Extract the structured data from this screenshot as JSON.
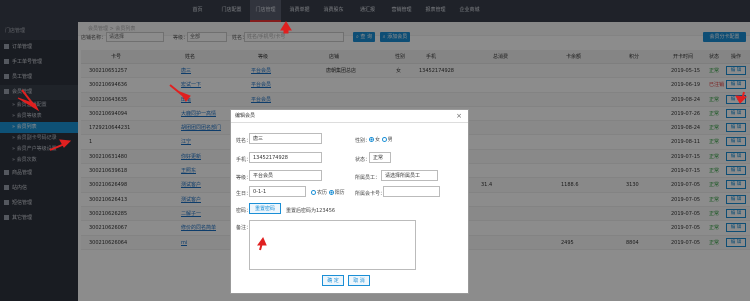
{
  "topnav": [
    "首页",
    "门店配置",
    "门店管理",
    "消费单据",
    "消费股东",
    "通汇报",
    "营销管理",
    "报表管理",
    "企业商城"
  ],
  "sidebar": {
    "head": "门店管理",
    "items": [
      {
        "label": "订单管理",
        "type": "top"
      },
      {
        "label": "手工单号管理",
        "type": "plain"
      },
      {
        "label": "员工管理",
        "type": "top"
      },
      {
        "label": "会员管理",
        "type": "open"
      },
      {
        "label": "» 会员营销配置",
        "type": "sub"
      },
      {
        "label": "» 会员等级表",
        "type": "sub"
      },
      {
        "label": "» 会员列表",
        "type": "sel"
      },
      {
        "label": "» 会员副卡号码记录",
        "type": "sub"
      },
      {
        "label": "» 会员产户等级设置",
        "type": "sub"
      },
      {
        "label": "» 会员次数",
        "type": "sub"
      },
      {
        "label": "商品管理",
        "type": "top"
      },
      {
        "label": "站内信",
        "type": "top"
      },
      {
        "label": "短信管理",
        "type": "top"
      },
      {
        "label": "其它管理",
        "type": "top"
      }
    ]
  },
  "breadcrumb": "会员管理 > 会员列表",
  "filter": {
    "store_label": "店铺名称：",
    "store_value": "请选择",
    "level_label": "等级：",
    "level_value": "全部",
    "name_label": "姓名：",
    "name_placeholder": "姓名/手机号/卡号",
    "search_btn": "查 询",
    "add_btn": "添加会员",
    "config_btn": "会员分卡配置"
  },
  "table": {
    "headers": [
      "卡号",
      "姓名",
      "等级",
      "店铺",
      "性别",
      "手机",
      "总消费",
      "卡余额",
      "积分",
      "开卡时间",
      "状态",
      "操作"
    ],
    "rows": [
      {
        "card": "300210651257",
        "name": "唐三",
        "level": "平台会员",
        "store": "唐朝集团总店",
        "sex": "女",
        "phone": "13452174928",
        "total": "",
        "balance": "",
        "points": "",
        "date": "2019-05-15",
        "status": "正常",
        "op": "编 辑"
      },
      {
        "card": "300210694636",
        "name": "宏试一下",
        "level": "平台会员",
        "store": "",
        "sex": "",
        "phone": "",
        "total": "",
        "balance": "",
        "points": "",
        "date": "2019-06-19",
        "status": "已注销",
        "op": "编 辑"
      },
      {
        "card": "300210643635",
        "name": "田龟",
        "level": "平台会员",
        "store": "",
        "sex": "",
        "phone": "",
        "total": "",
        "balance": "",
        "points": "",
        "date": "2019-08-24",
        "status": "正常",
        "op": "编 辑"
      },
      {
        "card": "300210694094",
        "name": "大鹿同护一高情",
        "level": "平台会员",
        "store": "",
        "sex": "",
        "phone": "",
        "total": "",
        "balance": "",
        "points": "",
        "date": "2019-07-26",
        "status": "正常",
        "op": "编 辑"
      },
      {
        "card": "1729210644231",
        "name": "胡团团同团名部门",
        "level": "平台会员",
        "store": "",
        "sex": "",
        "phone": "",
        "total": "",
        "balance": "",
        "points": "",
        "date": "2019-08-24",
        "status": "正常",
        "op": "编 辑"
      },
      {
        "card": "1",
        "name": "江宁",
        "level": "平台会员",
        "store": "",
        "sex": "",
        "phone": "",
        "total": "",
        "balance": "",
        "points": "",
        "date": "2019-08-11",
        "status": "正常",
        "op": "编 辑"
      },
      {
        "card": "300210631480",
        "name": "你好更新",
        "level": "平台会员",
        "store": "",
        "sex": "",
        "phone": "",
        "total": "",
        "balance": "",
        "points": "",
        "date": "2019-07-15",
        "status": "正常",
        "op": "编 辑"
      },
      {
        "card": "300210639618",
        "name": "王照东",
        "level": "平台会员",
        "store": "",
        "sex": "",
        "phone": "",
        "total": "",
        "balance": "",
        "points": "",
        "date": "2019-07-15",
        "status": "正常",
        "op": "编 辑"
      },
      {
        "card": "300210626498",
        "name": "测试客户",
        "level": "平台会员",
        "store": "",
        "sex": "",
        "phone": "",
        "total": "31.4",
        "balance": "1188.6",
        "points": "3130",
        "date": "2019-07-05",
        "status": "正常",
        "op": "编 辑"
      },
      {
        "card": "300210626413",
        "name": "测试客户",
        "level": "平台会员",
        "store": "",
        "sex": "",
        "phone": "",
        "total": "",
        "balance": "",
        "points": "",
        "date": "2019-07-05",
        "status": "正常",
        "op": "编 辑"
      },
      {
        "card": "300210626285",
        "name": "二解子一",
        "level": "平台会员",
        "store": "",
        "sex": "",
        "phone": "",
        "total": "",
        "balance": "",
        "points": "",
        "date": "2019-07-05",
        "status": "正常",
        "op": "编 辑"
      },
      {
        "card": "300210626067",
        "name": "修价的同名简单",
        "level": "平台会员",
        "store": "",
        "sex": "",
        "phone": "",
        "total": "",
        "balance": "",
        "points": "",
        "date": "2019-07-05",
        "status": "正常",
        "op": "编 辑"
      },
      {
        "card": "300210626064",
        "name": "mi",
        "level": "平台会员",
        "store": "",
        "sex": "",
        "phone": "",
        "total": "",
        "balance": "2495",
        "points": "8804",
        "date": "2019-07-05",
        "status": "正常",
        "op": "编 辑"
      }
    ]
  },
  "modal": {
    "title": "编辑会员",
    "close": "×",
    "name_label": "姓名：",
    "name_value": "唐三",
    "sex_label": "性别：",
    "sex_male": "女",
    "sex_female": "男",
    "phone_label": "手机：",
    "phone_value": "13452174928",
    "status_label": "状态：",
    "status_value": "正常",
    "level_label": "等级：",
    "level_value": "平台会员",
    "staff_label": "所属员工：",
    "staff_value": "请选择所属员工",
    "birthday_label": "生日：",
    "birthday_value": "0-1-1",
    "cal_solar": "农历",
    "cal_lunar": "阳历",
    "card_label": "所属会卡号：",
    "pwd_label": "密码：",
    "pwd_btn": "重置密码",
    "pwd_hint": "重置后密码为123456",
    "remark_label": "备注：",
    "ok_btn": "确 定",
    "cancel_btn": "取 消"
  },
  "colors": {
    "accent": "#1b8fd6",
    "arrow": "#e02020",
    "sidebar": "#2f343f"
  }
}
